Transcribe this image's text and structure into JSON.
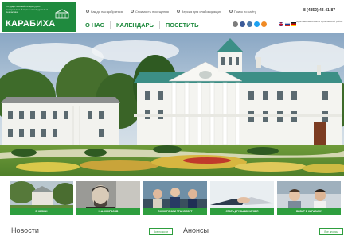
{
  "header": {
    "logo": {
      "small_text": "Государственный литературно-мемориальный музей-заповедник Н.А. Некрасова",
      "name": "КАРАБИХА"
    },
    "topbar": [
      {
        "icon": "location-pin-icon",
        "label": "Как до нас добраться"
      },
      {
        "icon": "ticket-icon",
        "label": "Стоимость посещения"
      },
      {
        "icon": "eye-icon",
        "label": "Версия для слабовидящих"
      },
      {
        "icon": "search-icon",
        "label": "Поиск по сайту"
      }
    ],
    "phone": "8 (4852) 43-41-87",
    "nav": [
      "О НАС",
      "КАЛЕНДАРЬ",
      "ПОСЕТИТЬ"
    ],
    "address": "Ярославская область Ярославский район",
    "colors": {
      "brand": "#1f8a3e",
      "accent": "#2e9e3e"
    }
  },
  "tiles": [
    {
      "label": "В ЖИЗНИ"
    },
    {
      "label": "Н.А. НЕКРАСОВ"
    },
    {
      "label": "ЭКСКУРСИИ И ТРАНСПОРТ"
    },
    {
      "label": "СТАТЬ ДРУЗЬЯМИ МУЗЕЯ"
    },
    {
      "label": "ВИЗИТ В КАРАБИХУ"
    }
  ],
  "sections": {
    "news": {
      "title": "Новости",
      "button": "Все новости"
    },
    "announces": {
      "title": "Анонсы",
      "button": "Все анонсы"
    }
  }
}
